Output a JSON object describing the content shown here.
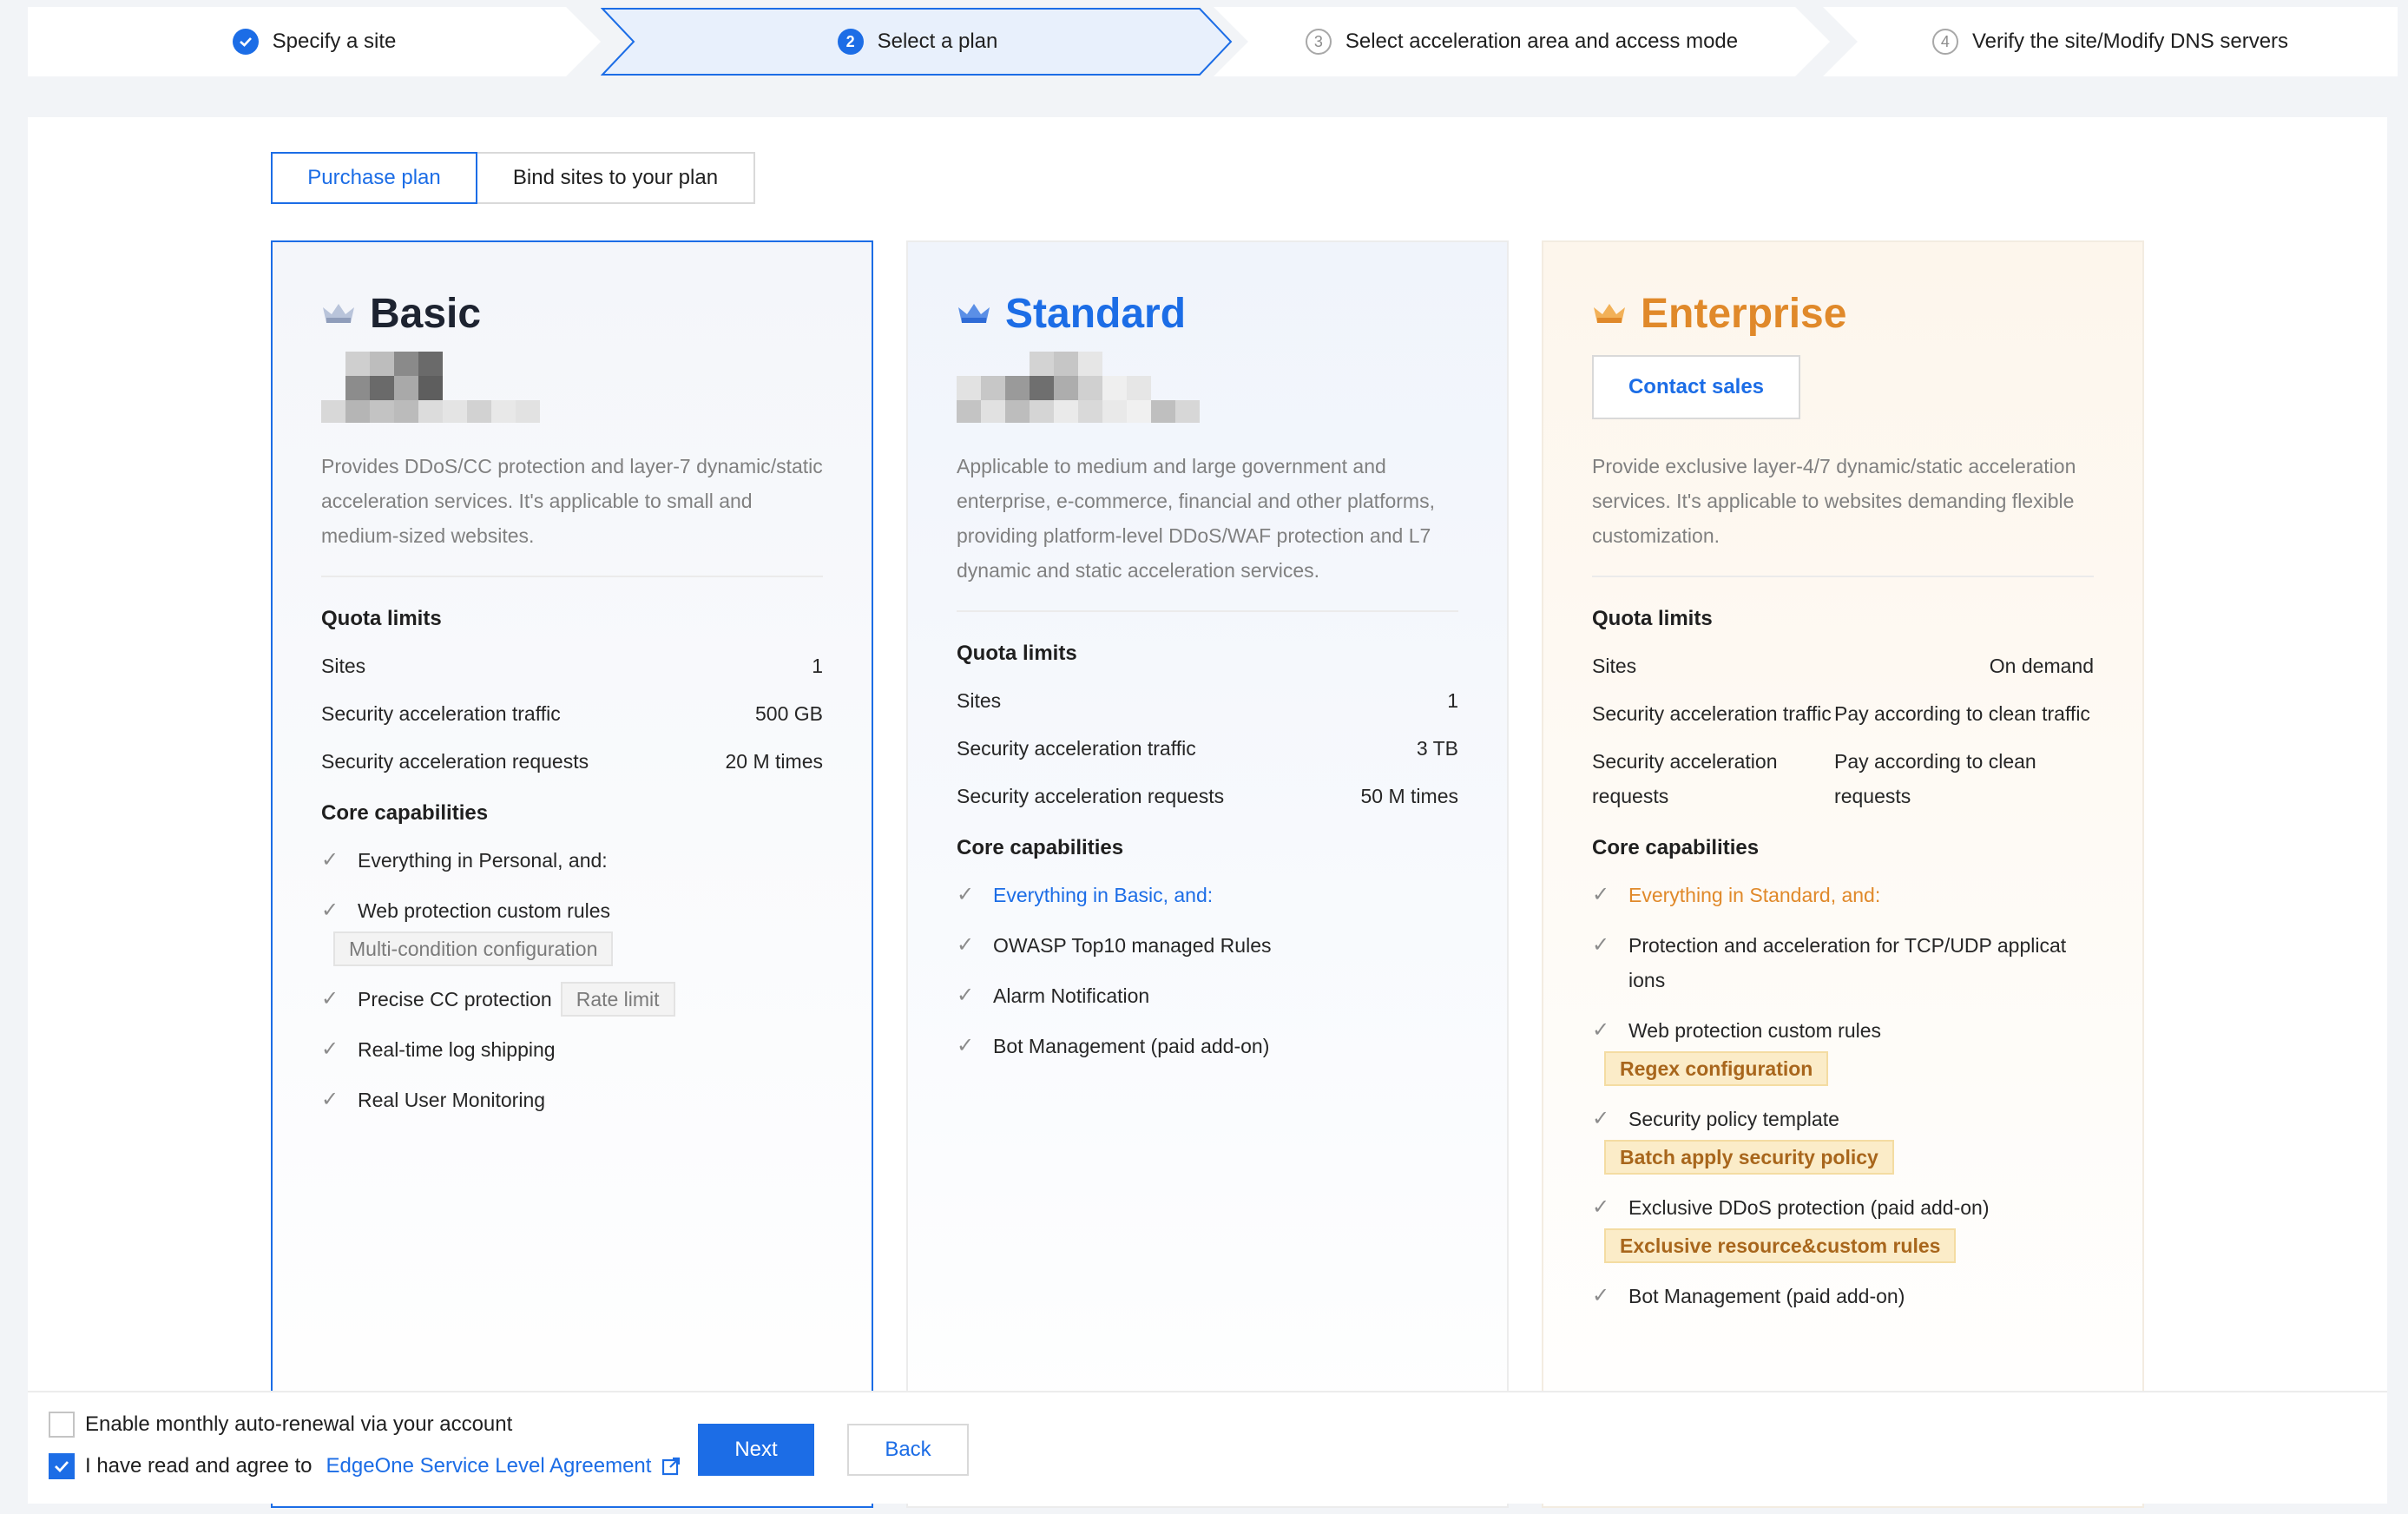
{
  "stepper": {
    "steps": [
      {
        "number": "",
        "label": "Specify a site",
        "state": "done"
      },
      {
        "number": "2",
        "label": "Select a plan",
        "state": "active"
      },
      {
        "number": "3",
        "label": "Select acceleration area and access mode",
        "state": "todo"
      },
      {
        "number": "4",
        "label": "Verify the site/Modify DNS servers",
        "state": "todo"
      }
    ]
  },
  "tabs": {
    "purchase": "Purchase plan",
    "bind": "Bind sites to your plan"
  },
  "plans": {
    "basic": {
      "name": "Basic",
      "description": "Provides DDoS/CC protection and layer-7 dynamic/static acceleration services. It's applicable to small and medium-sized websites.",
      "quota_title": "Quota limits",
      "quotas": [
        {
          "label": "Sites",
          "value": "1"
        },
        {
          "label": "Security acceleration traffic",
          "value": "500 GB"
        },
        {
          "label": "Security acceleration requests",
          "value": "20 M times"
        }
      ],
      "core_title": "Core capabilities",
      "caps": [
        {
          "text": "Everything in Personal, and:"
        },
        {
          "text": "Web protection custom rules",
          "tag": "Multi-condition configuration"
        },
        {
          "text": "Precise CC protection",
          "tag": "Rate limit"
        },
        {
          "text": "Real-time log shipping"
        },
        {
          "text": "Real User Monitoring"
        }
      ]
    },
    "standard": {
      "name": "Standard",
      "description": "Applicable to medium and large government and enterprise, e-commerce, financial and other platforms, providing platform-level DDoS/WAF protection and L7 dynamic and static acceleration services.",
      "quota_title": "Quota limits",
      "quotas": [
        {
          "label": "Sites",
          "value": "1"
        },
        {
          "label": "Security acceleration traffic",
          "value": "3 TB"
        },
        {
          "label": "Security acceleration requests",
          "value": "50 M times"
        }
      ],
      "core_title": "Core capabilities",
      "caps": [
        {
          "text": "Everything in Basic, and:"
        },
        {
          "text": "OWASP Top10 managed Rules"
        },
        {
          "text": "Alarm Notification"
        },
        {
          "text": "Bot Management (paid add-on)"
        }
      ]
    },
    "enterprise": {
      "name": "Enterprise",
      "contact": "Contact sales",
      "description": "Provide exclusive layer-4/7 dynamic/static acceleration services. It's applicable to websites demanding flexible customization.",
      "quota_title": "Quota limits",
      "quotas": [
        {
          "label": "Sites",
          "value": "On demand"
        },
        {
          "label": "Security acceleration traffic",
          "value": "Pay according to clean traffic"
        },
        {
          "label": "Security acceleration requests",
          "value": "Pay according to clean requests"
        }
      ],
      "core_title": "Core capabilities",
      "caps": [
        {
          "text": "Everything in Standard, and:"
        },
        {
          "text": "Protection and acceleration for TCP/UDP applicat ions"
        },
        {
          "text": "Web protection custom rules",
          "tag": "Regex configuration"
        },
        {
          "text": "Security policy template",
          "tag": "Batch apply security policy"
        },
        {
          "text": "Exclusive DDoS protection (paid add-on)",
          "tag": "Exclusive resource&custom rules"
        },
        {
          "text": "Bot Management (paid add-on)"
        }
      ]
    }
  },
  "footer": {
    "auto_renew": "Enable monthly auto-renewal via your account",
    "agree_prefix": "I have read and agree to",
    "agree_link": "EdgeOne Service Level Agreement",
    "next": "Next",
    "back": "Back"
  },
  "colors": {
    "accent": "#1c6de6",
    "enterprise": "#e0892a",
    "tag_gold_bg": "#fbecc8"
  }
}
